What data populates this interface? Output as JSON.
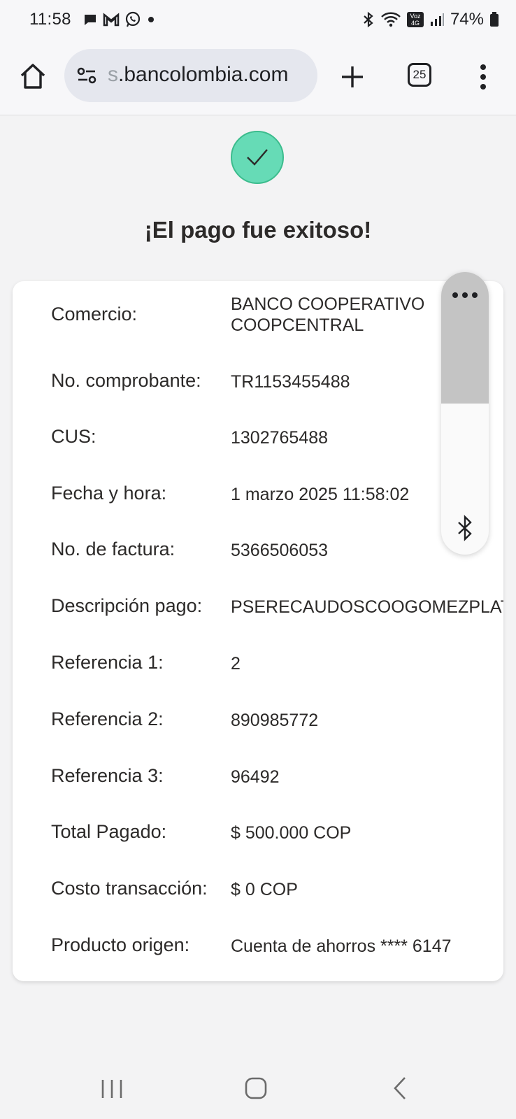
{
  "status_bar": {
    "time": "11:58",
    "network_badge": "Voz 4G",
    "battery": "74%"
  },
  "browser": {
    "url_faded": "s",
    "url_main": ".bancolombia.com",
    "tab_count": "25"
  },
  "receipt": {
    "title": "¡El pago fue exitoso!",
    "rows": [
      {
        "label": "Comercio:",
        "value_line1": "BANCO COOPERATIVO",
        "value_line2": "COOPCENTRAL"
      },
      {
        "label": "No. comprobante:",
        "value": "TR1153455488"
      },
      {
        "label": "CUS:",
        "value": "1302765488"
      },
      {
        "label": "Fecha y hora:",
        "value": "1 marzo 2025 11:58:02"
      },
      {
        "label": "No. de factura:",
        "value": "5366506053"
      },
      {
        "label": "Descripción pago:",
        "value": "PSERECAUDOSCOOGOMEZPLATA"
      },
      {
        "label": "Referencia 1:",
        "value": "2"
      },
      {
        "label": "Referencia 2:",
        "value": "890985772"
      },
      {
        "label": "Referencia 3:",
        "value": "96492"
      },
      {
        "label": "Total Pagado:",
        "value": "$ 500.000 COP"
      },
      {
        "label": "Costo transacción:",
        "value": "$ 0 COP"
      },
      {
        "label": "Producto origen:",
        "value": "Cuenta de ahorros **** 6147"
      }
    ]
  },
  "colors": {
    "success_green": "#66dbb6",
    "text_dark": "#2c2a29",
    "page_bg": "#f3f3f4"
  },
  "icons": {
    "status": [
      "chat-bubble-icon",
      "gmail-icon",
      "whatsapp-icon",
      "dot-icon",
      "bluetooth-icon",
      "wifi-icon",
      "signal-icon",
      "battery-icon"
    ],
    "toolbar": [
      "home-icon",
      "tune-icon",
      "plus-icon",
      "tabs-icon",
      "more-vert-icon"
    ],
    "nav": [
      "recent-apps-icon",
      "home-nav-icon",
      "back-icon"
    ]
  }
}
